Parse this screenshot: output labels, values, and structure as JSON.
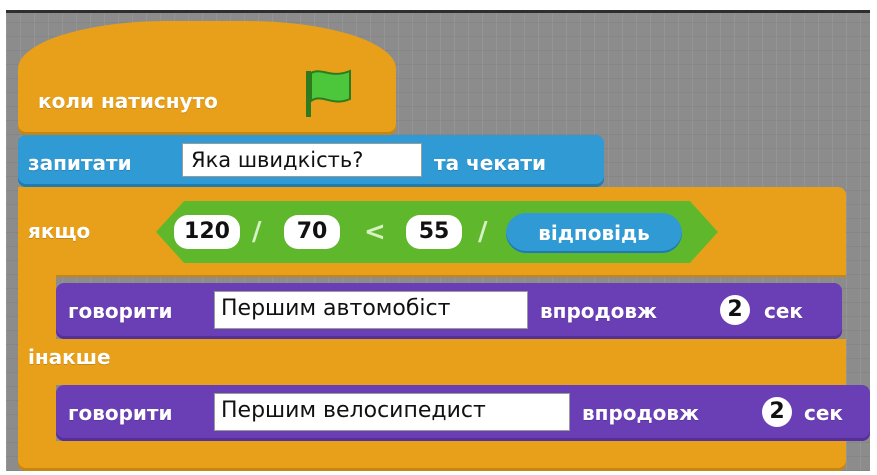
{
  "hat_block": {
    "label": "коли натиснуто",
    "icon": "green-flag-icon"
  },
  "ask_block": {
    "label_pre": "запитати",
    "question": "Яка швидкість?",
    "label_post": "та чекати"
  },
  "if_block": {
    "label": "якщо",
    "condition": {
      "left_num1": "120",
      "div1": "/",
      "left_num2": "70",
      "compare": "<",
      "right_num": "55",
      "div2": "/",
      "reporter": "відповідь"
    },
    "else_label": "інакше"
  },
  "say_block_1": {
    "label_pre": "говорити",
    "message": "Першим автомобіст",
    "label_mid": "впродовж",
    "seconds": "2",
    "label_post": "сек"
  },
  "say_block_2": {
    "label_pre": "говорити",
    "message": "Першим велосипедист",
    "label_mid": "впродовж",
    "seconds": "2",
    "label_post": "сек"
  },
  "colors": {
    "events": "#e8a01a",
    "sensing": "#2f9ad3",
    "operators": "#5fb82c",
    "looks": "#6a3fb5",
    "flag": "#4cc63a"
  }
}
